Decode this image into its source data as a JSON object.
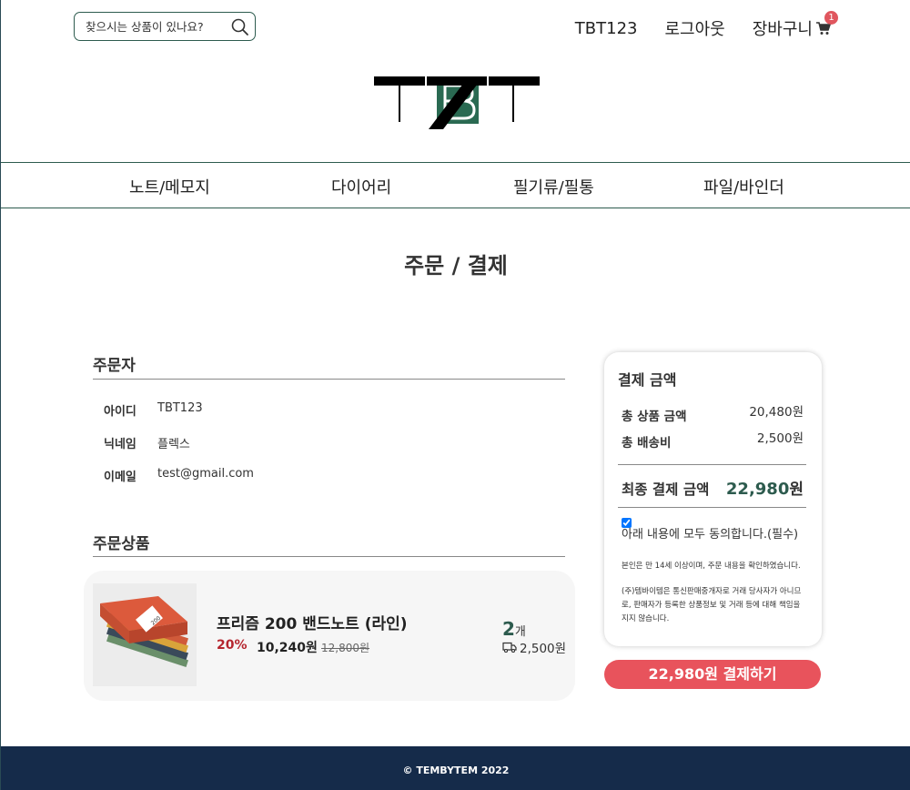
{
  "header": {
    "search_placeholder": "찾으시는 상품이 있나요?",
    "user_id": "TBT123",
    "logout": "로그아웃",
    "cart_label": "장바구니",
    "cart_count": "1",
    "logo_icon": "tbt-logo-icon"
  },
  "nav": {
    "items": [
      {
        "label": "노트/메모지"
      },
      {
        "label": "다이어리"
      },
      {
        "label": "필기류/필통"
      },
      {
        "label": "파일/바인더"
      }
    ]
  },
  "page": {
    "title": "주문 / 결제"
  },
  "orderer": {
    "title": "주문자",
    "fields": [
      {
        "label": "아이디",
        "value": "TBT123"
      },
      {
        "label": "닉네임",
        "value": "플렉스"
      },
      {
        "label": "이메일",
        "value": "test@gmail.com"
      }
    ]
  },
  "products": {
    "title": "주문상품",
    "items": [
      {
        "name": "프리즘 200 밴드노트 (라인)",
        "discount": "20%",
        "price": "10,240원",
        "original_price": "12,800원",
        "quantity": "2",
        "quantity_unit": "개",
        "shipping": "2,500원",
        "thumb_label": "200"
      }
    ]
  },
  "payment": {
    "title": "결제 금액",
    "subtotal_label": "총 상품 금액",
    "subtotal_value": "20,480원",
    "shipping_label": "총 배송비",
    "shipping_value": "2,500원",
    "final_label": "최종 결제 금액",
    "final_amount": "22,980",
    "final_unit": "원",
    "agree_text": "아래 내용에 모두 동의합니다.(필수)",
    "notice_1": "본인은 만 14세 이상이며, 주문 내용을 확인하였습니다.",
    "notice_2": "(주)템바이템은 통신판매중개자로 거래 당사자가 아니므로, 판매자가 등록한 상품정보 및 거래 등에 대해 책임을 지지 않습니다.",
    "button_label": "22,980원 결제하기"
  },
  "footer": {
    "copyright": "© TEMBYTEM 2022"
  },
  "colors": {
    "brand_green": "#2d5b4e",
    "accent_red": "#e8535c",
    "footer_navy": "#152b4a"
  }
}
